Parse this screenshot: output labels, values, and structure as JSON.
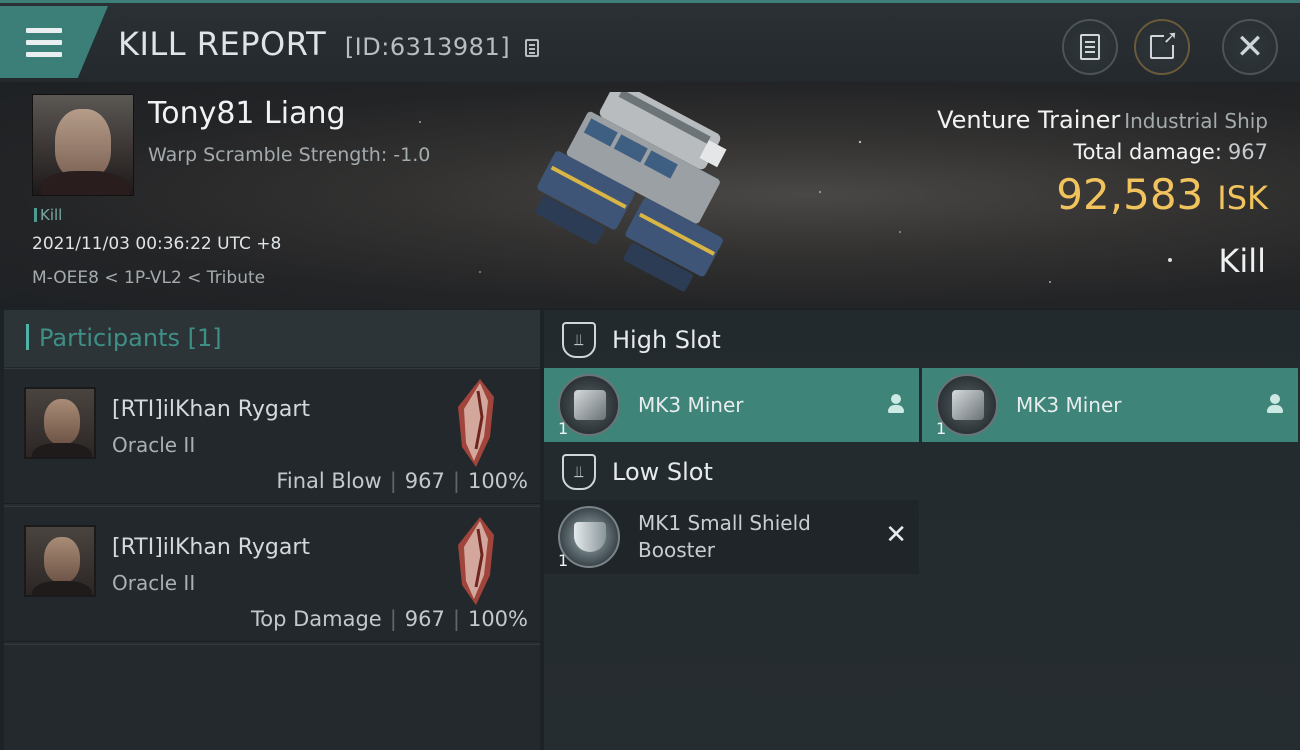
{
  "header": {
    "title": "KILL REPORT",
    "id_label": "[ID:6313981]"
  },
  "victim": {
    "name": "Tony81 Liang",
    "warp_scramble": "Warp Scramble Strength: -1.0",
    "kill_tag": "Kill",
    "datetime": "2021/11/03 00:36:22 UTC +8",
    "location": "M-OEE8 < 1P-VL2 < Tribute",
    "ship_name": "Venture Trainer",
    "ship_class": "Industrial Ship",
    "total_damage_label": "Total damage:",
    "total_damage_value": "967",
    "isk_value": "92,583",
    "isk_unit": "ISK",
    "result": "Kill"
  },
  "participants": {
    "title": "Participants",
    "count": "[1]",
    "rows": [
      {
        "name": "[RTI]ilKhan Rygart",
        "ship": "Oracle II",
        "role": "Final Blow",
        "damage": "967",
        "percent": "100%"
      },
      {
        "name": "[RTI]ilKhan Rygart",
        "ship": "Oracle II",
        "role": "Top Damage",
        "damage": "967",
        "percent": "100%"
      }
    ]
  },
  "slots": {
    "high_title": "High Slot",
    "low_title": "Low Slot",
    "high": [
      {
        "name": "MK3 Miner",
        "qty": "1"
      },
      {
        "name": "MK3 Miner",
        "qty": "1"
      }
    ],
    "low": [
      {
        "name_line1": "MK1 Small Shield",
        "name_line2": "Booster",
        "qty": "1"
      }
    ]
  },
  "colors": {
    "accent_teal": "#3e8479",
    "isk_gold": "#f1c35c",
    "header_bg": "#262c30"
  },
  "icons": [
    "menu-icon",
    "copy-icon",
    "report-icon",
    "share-icon",
    "close-icon",
    "pilot-icon",
    "destroyed-icon",
    "slot-shield-icon"
  ]
}
